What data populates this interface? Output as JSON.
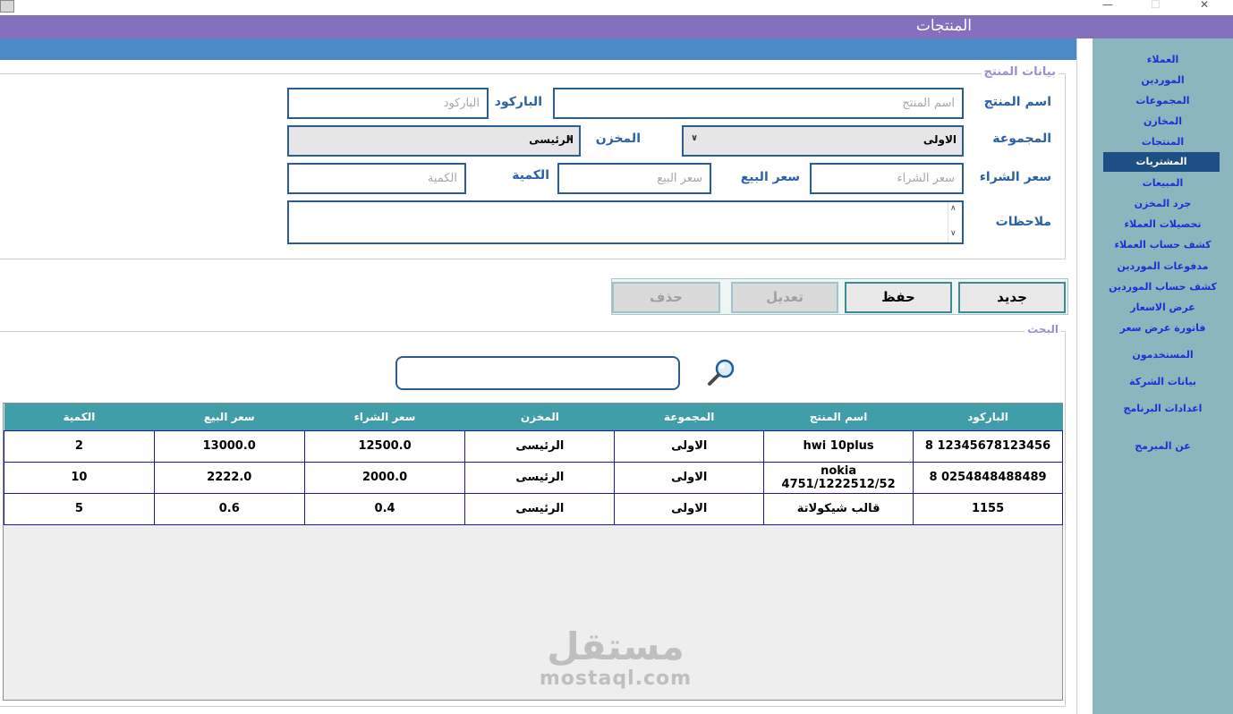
{
  "window": {
    "title": "المنتجات",
    "controls": {
      "minimize": "—",
      "maximize": "☐",
      "close": "✕"
    }
  },
  "sidebar": {
    "items": [
      {
        "label": "العملاء",
        "active": false
      },
      {
        "label": "الموردين",
        "active": false
      },
      {
        "label": "المجموعات",
        "active": false
      },
      {
        "label": "المخازن",
        "active": false
      },
      {
        "label": "المنتجات",
        "active": false
      },
      {
        "label": "المشتريات",
        "active": true
      },
      {
        "label": "المبيعات",
        "active": false
      },
      {
        "label": "جرد المخزن",
        "active": false
      },
      {
        "label": "تحصيلات العملاء",
        "active": false
      },
      {
        "label": "كشف حساب العملاء",
        "active": false
      },
      {
        "label": "مدفوعات  الموردين",
        "active": false
      },
      {
        "label": "كشف حساب  الموردين",
        "active": false
      },
      {
        "label": "عرض الاسعار",
        "active": false
      },
      {
        "label": "فاتورة عرض سعر",
        "active": false
      },
      {
        "label": "المستخدمون",
        "active": false
      },
      {
        "label": "بيانات الشركة",
        "active": false
      },
      {
        "label": "اعدادات البرنامج",
        "active": false
      },
      {
        "label": "عن المبرمج",
        "active": false
      }
    ]
  },
  "product_form": {
    "legend": "بيانات المنتج",
    "name_label": "اسم المنتج",
    "name_placeholder": "اسم المنتج",
    "barcode_label": "الباركود",
    "barcode_placeholder": "الباركود",
    "group_label": "المجموعة",
    "group_value": "الاولى",
    "store_label": "المخزن",
    "store_value": "الرئيسى",
    "buy_label": "سعر الشراء",
    "buy_placeholder": "سعر الشراء",
    "sell_label": "سعر البيع",
    "sell_placeholder": "سعر البيع",
    "qty_label": "الكمية",
    "qty_placeholder": "الكمية",
    "notes_label": "ملاحظات"
  },
  "buttons": {
    "new": "جديد",
    "save": "حفظ",
    "edit": "تعديل",
    "delete": "حذف"
  },
  "search": {
    "legend": "البحث",
    "value": ""
  },
  "table": {
    "columns": [
      "الباركود",
      "اسم المنتج",
      "المجموعة",
      "المخزن",
      "سعر الشراء",
      "سعر البيع",
      "الكمية"
    ],
    "rows": [
      [
        "12345678123456 8",
        "hwi 10plus",
        "الاولى",
        "الرئيسى",
        "12500.0",
        "13000.0",
        "2"
      ],
      [
        "0254848488489 8",
        "nokia 4751/1222512/52",
        "الاولى",
        "الرئيسى",
        "2000.0",
        "2222.0",
        "10"
      ],
      [
        "1155",
        "قالب شيكولاتة",
        "الاولى",
        "الرئيسى",
        "0.4",
        "0.6",
        "5"
      ]
    ]
  },
  "watermark": {
    "arabic": "مستقل",
    "latin": "mostaql.com"
  },
  "colors": {
    "header": "#8470bd",
    "accent_bar": "#4b8ac6",
    "sidebar": "#8cb6bd",
    "sidebar_active": "#1c4f86",
    "table_header": "#3f9ea7"
  }
}
